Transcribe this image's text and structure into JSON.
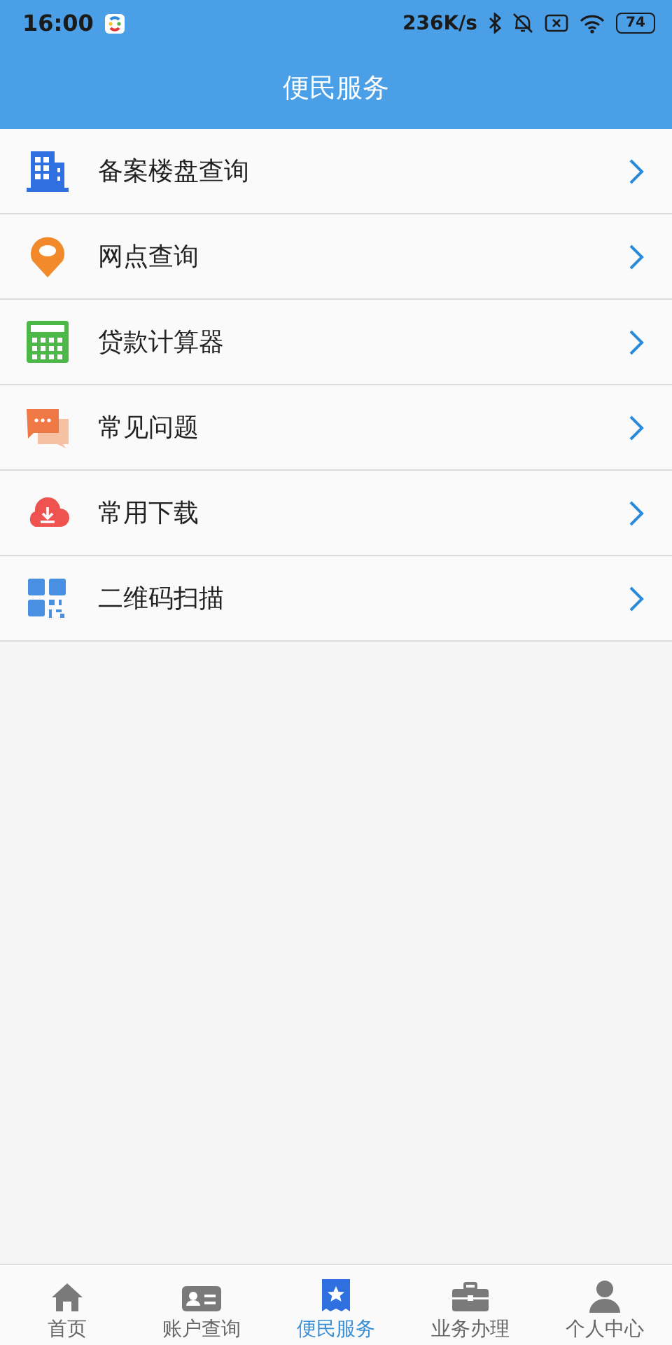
{
  "status_bar": {
    "time": "16:00",
    "speed": "236K/s",
    "battery": "74"
  },
  "header": {
    "title": "便民服务"
  },
  "menu": [
    {
      "label": "备案楼盘查询"
    },
    {
      "label": "网点查询"
    },
    {
      "label": "贷款计算器"
    },
    {
      "label": "常见问题"
    },
    {
      "label": "常用下载"
    },
    {
      "label": "二维码扫描"
    }
  ],
  "tabs": [
    {
      "label": "首页",
      "selected": false
    },
    {
      "label": "账户查询",
      "selected": false
    },
    {
      "label": "便民服务",
      "selected": true
    },
    {
      "label": "业务办理",
      "selected": false
    },
    {
      "label": "个人中心",
      "selected": false
    }
  ]
}
